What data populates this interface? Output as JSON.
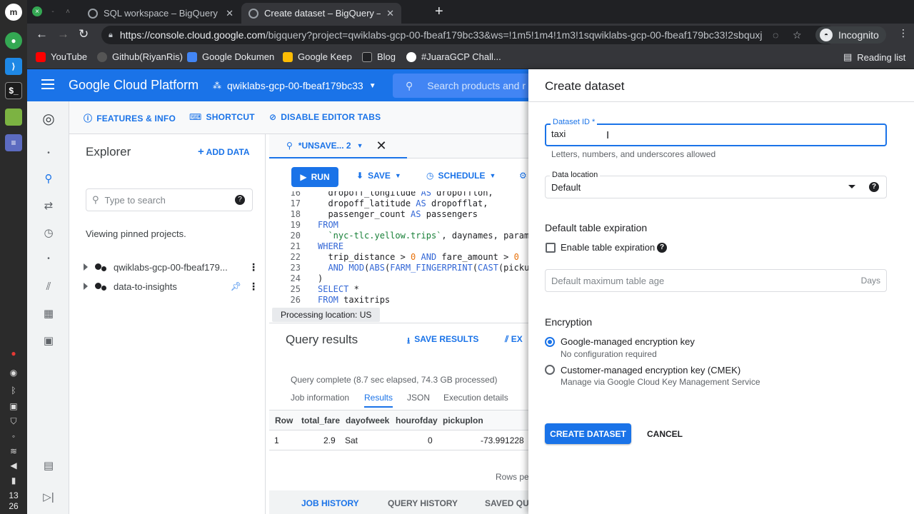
{
  "taskbar": {
    "clock_hour": "13",
    "clock_minute": "26"
  },
  "browser": {
    "tabs": [
      {
        "title": "SQL workspace – BigQuery – c",
        "active": false
      },
      {
        "title": "Create dataset – BigQuery – c",
        "active": true
      }
    ],
    "url_host": "https://console.cloud.google.com",
    "url_rest": "/bigquery?project=qwiklabs-gcp-00-fbeaf179bc33&ws=!1m5!1m4!1m3!1sqwiklabs-gcp-00-fbeaf179bc33!2sbquxjob_...",
    "incognito_label": "Incognito",
    "reading_list": "Reading list",
    "bookmarks": [
      "YouTube",
      "Github(RiyanRis)",
      "Google Dokumen",
      "Google Keep",
      "Blog",
      "#JuaraGCP Chall..."
    ]
  },
  "gcp": {
    "logo": "Google Cloud Platform",
    "project": "qwiklabs-gcp-00-fbeaf179bc33",
    "search_placeholder": "Search products and r"
  },
  "subbar": {
    "features": "FEATURES & INFO",
    "shortcut": "SHORTCUT",
    "disable_tabs": "DISABLE EDITOR TABS"
  },
  "explorer": {
    "title": "Explorer",
    "add_data": "ADD DATA",
    "search_placeholder": "Type to search",
    "pinned_text": "Viewing pinned projects.",
    "projects": [
      "qwiklabs-gcp-00-fbeaf179...",
      "data-to-insights"
    ]
  },
  "editor": {
    "tab_label": "*UNSAVE... 2",
    "run": "RUN",
    "save": "SAVE",
    "schedule": "SCHEDULE",
    "processing_location": "Processing location: US"
  },
  "results": {
    "title": "Query results",
    "save_results": "SAVE RESULTS",
    "export": "EX",
    "status": "Query complete (8.7 sec elapsed, 74.3 GB processed)",
    "tabs": [
      "Job information",
      "Results",
      "JSON",
      "Execution details"
    ],
    "columns": [
      "Row",
      "total_fare",
      "dayofweek",
      "hourofday",
      "pickuplon"
    ],
    "rows": [
      [
        "1",
        "2.9",
        "Sat",
        "0",
        "-73.991228"
      ]
    ],
    "rows_per_page": "Rows per",
    "bottom_tabs": [
      "JOB HISTORY",
      "QUERY HISTORY",
      "SAVED QUE"
    ]
  },
  "panel": {
    "title": "Create dataset",
    "dataset_id_label": "Dataset ID *",
    "dataset_id_value": "taxi",
    "dataset_id_hint": "Letters, numbers, and underscores allowed",
    "location_label": "Data location",
    "location_value": "Default",
    "expiration_title": "Default table expiration",
    "enable_expiration": "Enable table expiration",
    "max_age_placeholder": "Default maximum table age",
    "max_age_unit": "Days",
    "encryption_title": "Encryption",
    "google_key": "Google-managed encryption key",
    "google_key_sub": "No configuration required",
    "cmek": "Customer-managed encryption key (CMEK)",
    "cmek_sub": "Manage via Google Cloud Key Management Service",
    "create": "CREATE DATASET",
    "cancel": "CANCEL"
  },
  "colors": {
    "accent": "#1a73e8",
    "header": "#1a73e8",
    "chrome_dark": "#202124"
  }
}
